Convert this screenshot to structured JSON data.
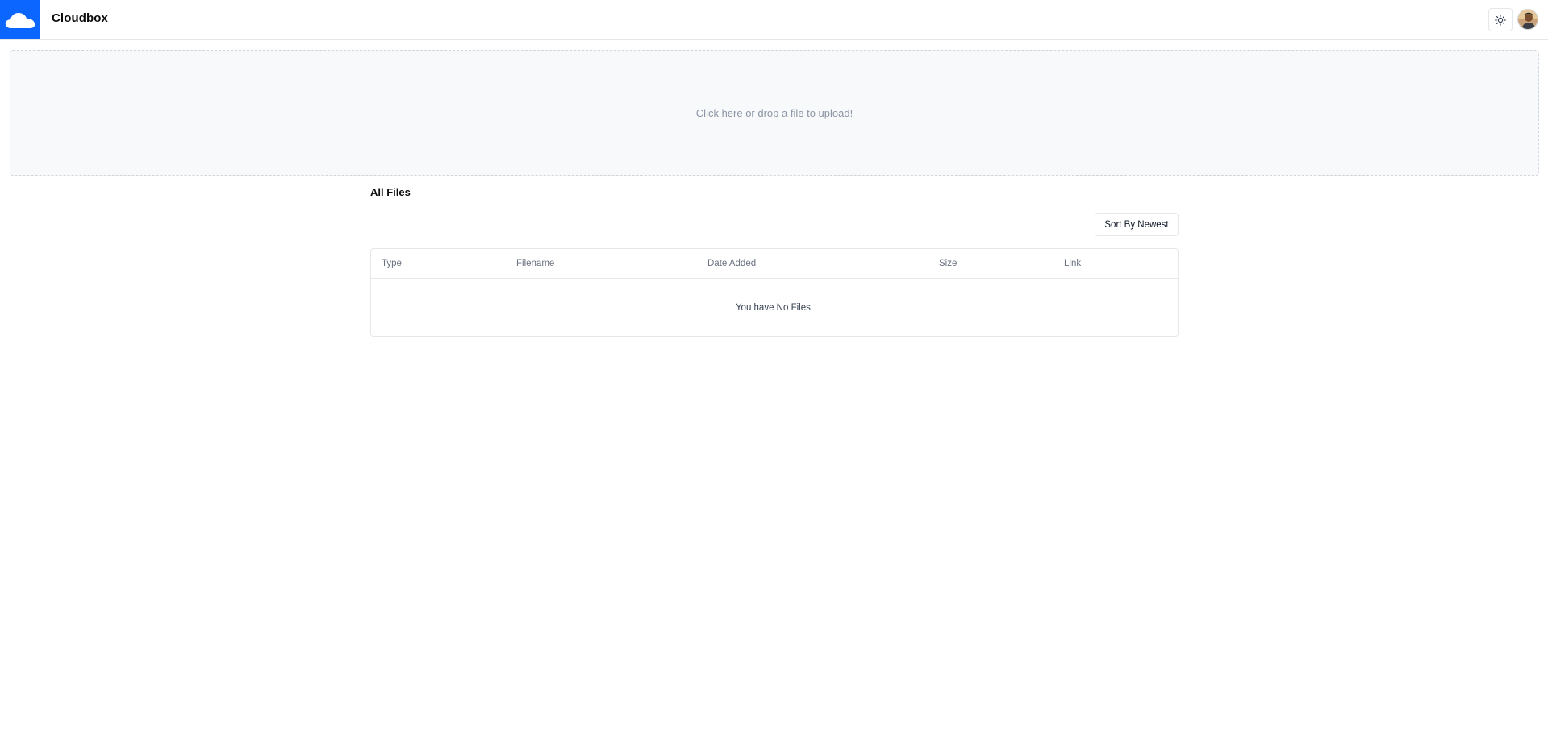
{
  "header": {
    "app_name": "Cloudbox",
    "logo_icon": "cloud-icon",
    "theme_icon": "sun-icon",
    "brand_color": "#0a66ff"
  },
  "upload": {
    "prompt": "Click here or drop a file to upload!"
  },
  "files": {
    "title": "All Files",
    "sort_label": "Sort By Newest",
    "columns": [
      "Type",
      "Filename",
      "Date Added",
      "Size",
      "Link"
    ],
    "empty_message": "You have No Files."
  }
}
